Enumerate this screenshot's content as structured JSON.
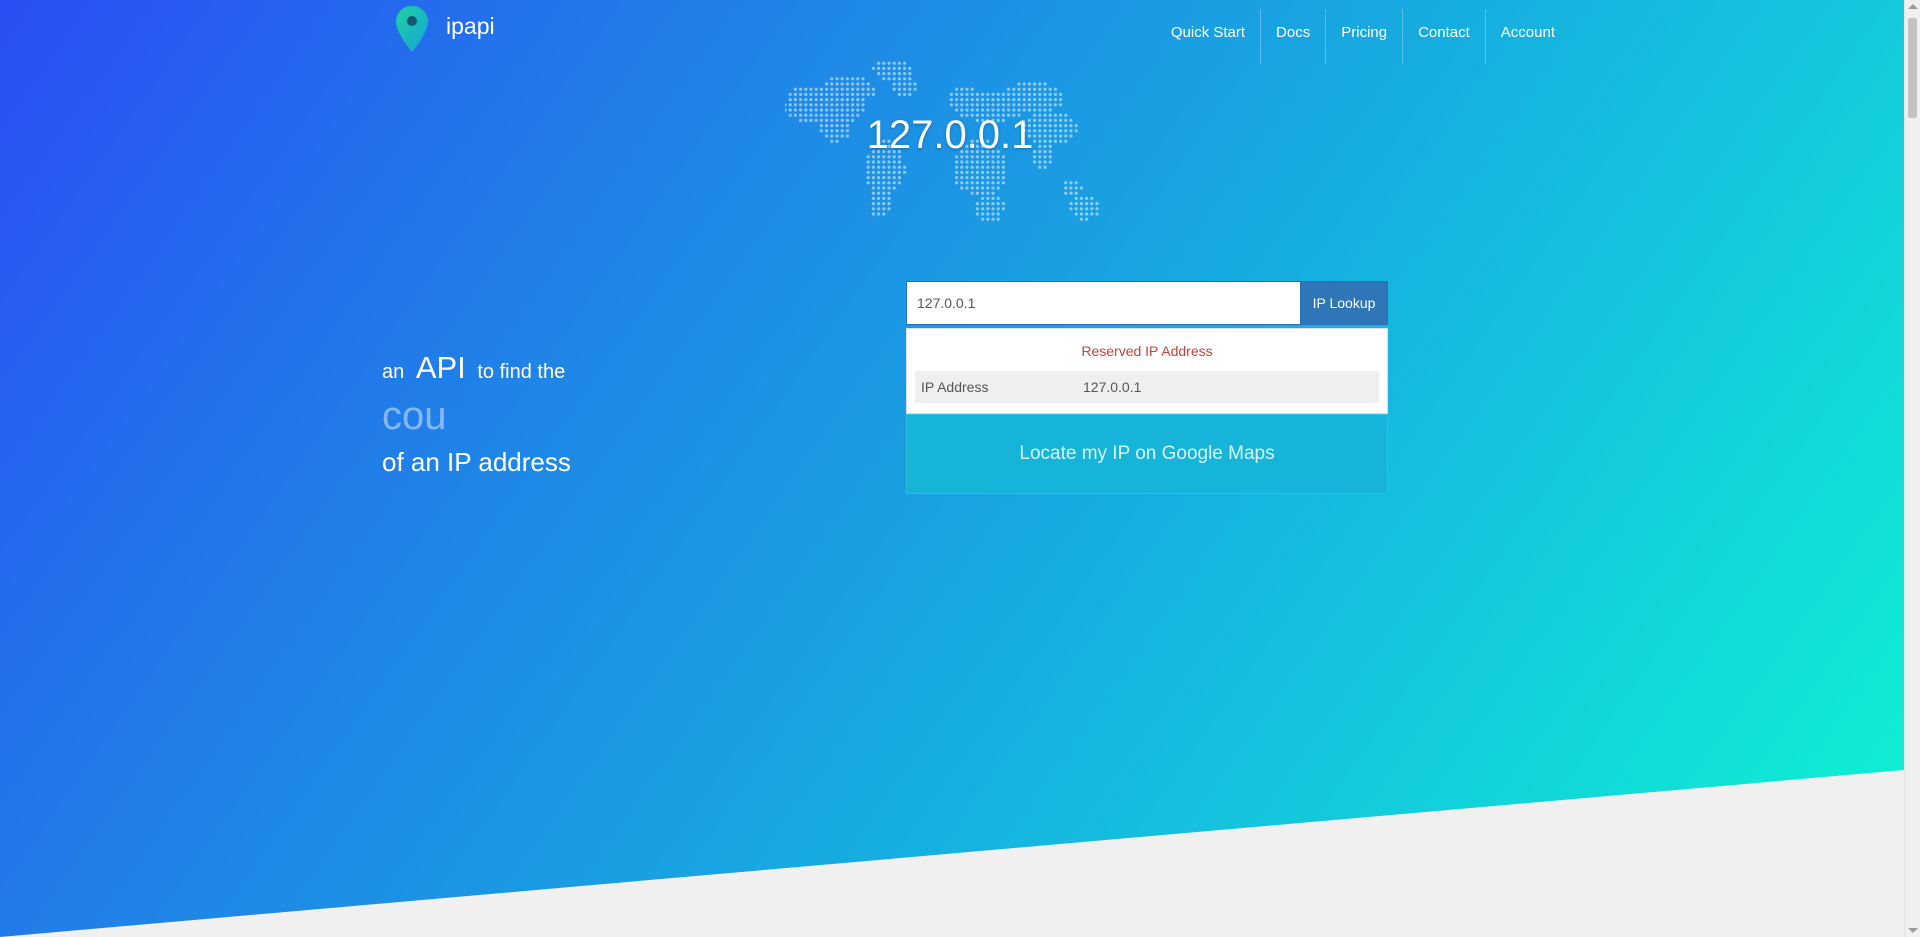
{
  "brand": {
    "name": "ipapi"
  },
  "nav": [
    {
      "label": "Quick Start"
    },
    {
      "label": "Docs"
    },
    {
      "label": "Pricing"
    },
    {
      "label": "Contact"
    },
    {
      "label": "Account"
    }
  ],
  "hero": {
    "ip_display": "127.0.0.1"
  },
  "tagline": {
    "prefix": "an",
    "api": "API",
    "suffix": "to find the",
    "rotating_word": "cou",
    "line3": "of an IP address"
  },
  "lookup": {
    "input_value": "127.0.0.1",
    "button_label": "IP Lookup",
    "status": "Reserved IP Address",
    "rows": [
      {
        "key": "IP Address",
        "value": "127.0.0.1"
      }
    ],
    "maps_link": "Locate my IP on Google Maps"
  },
  "colors": {
    "gradient_start": "#2a4ef5",
    "gradient_end": "#0ff5cf",
    "button": "#2f76b9",
    "status_red": "#c7423a",
    "maps_box": "#16b4d8"
  },
  "icons": {
    "logo": "map-pin-icon",
    "background": "world-map-dots"
  }
}
